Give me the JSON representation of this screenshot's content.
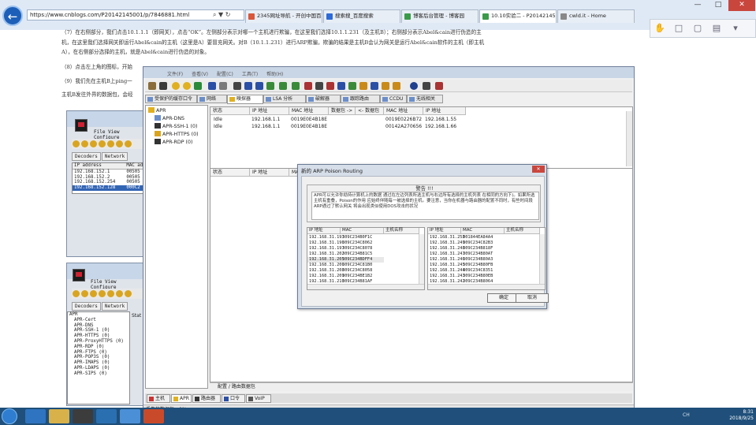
{
  "browser": {
    "address": "https://www.cnblogs.com/P20142145001/p/7846881.html",
    "tabs": [
      "2345网址导航 - 开创中国百年...",
      "搜索搜_百度搜索",
      "博客后台管理 - 博客园",
      "10.10实验二 - P20142145...",
      "cwld.it - Home"
    ],
    "window_buttons": [
      "—",
      "□",
      "✕"
    ]
  },
  "article": {
    "p1": "（7）在右侧部分，我们点击10.1.1.1（即网关），点击“OK”。左侧部分表示对哪一个主机进行欺骗，在这里我们选择10.1.1.231（及主机B）；右侧部分表示Abel&cain进行伪造的主",
    "p1b": "机，在这里我们选择网关即运行Abel&cain的主机（这里是A）要冒充网关。对B（10.1.1.231）进行ARP欺骗，欺骗的结果是主机B会认为网关是运行Abel&cain软件的主机（即主机",
    "p1c": "A），在右侧部分选择的主机，就是Abel&cain进行伪造的对象。",
    "p2": "（8）点击左上角的图标，开始",
    "p3": "（9）我们先在主机B上ping一",
    "p4": "主机B发往外界的数据包，会经"
  },
  "small_win1": {
    "menu": "File  View  Configure",
    "tabs": [
      "Decoders",
      "Network"
    ],
    "table_header": "IP address",
    "table_header2": "MAC ad",
    "rows": [
      {
        "ip": "192.168.152.1",
        "mac": "00505"
      },
      {
        "ip": "192.168.152.2",
        "mac": "00505"
      },
      {
        "ip": "192.168.152.254",
        "mac": "00505"
      },
      {
        "ip": "192.168.152.128",
        "mac": "000C2"
      }
    ]
  },
  "small_win2": {
    "menu": "File  View  Configure",
    "tabs": [
      "Decoders",
      "Network"
    ],
    "stat": "Stat",
    "tree": [
      "APR",
      "APR-Cert",
      "APR-DNS",
      "APR-SSH-1 (0)",
      "APR-HTTPS (0)",
      "APR-ProxyHTTPS (0)",
      "APR-RDP (0)",
      "APR-FTPS (0)",
      "APR-POP3S (0)",
      "APR-IMAPS (0)",
      "APR-LDAPS (0)",
      "APR-SIPS (0)"
    ]
  },
  "cain": {
    "menu": [
      "文件(F)",
      "查看(V)",
      "配置(C)",
      "工具(T)",
      "帮助(H)"
    ],
    "tabs": [
      "受保护的缓存口令",
      "网络",
      "嗅探器",
      "LSA 分析",
      "破解器",
      "跟踪路由",
      "CCDU",
      "无线相关"
    ],
    "tree": [
      "APR",
      "APR-DNS",
      "APR-SSH-1 (0)",
      "APR-HTTPS (0)",
      "APR-RDP (0)"
    ],
    "table1_headers": [
      "状态",
      "IP 地址",
      "MAC 地址",
      "数据包 ->",
      "<- 数据包",
      "MAC 地址",
      "IP 地址"
    ],
    "table1_rows": [
      [
        "Idle",
        "192.168.1.1",
        "0019E0E4B18E",
        "",
        "",
        "0019E0226B72",
        "192.168.1.55"
      ],
      [
        "Idle",
        "192.168.1.1",
        "0019E0E4B18E",
        "",
        "",
        "00142A270656",
        "192.168.1.66"
      ]
    ],
    "table2_headers": [
      "状态",
      "IP 地址",
      "MAC 地址"
    ],
    "bottom_tab": "配置 / 路由数据包",
    "bottom_tabs": [
      "主机",
      "APR",
      "路由器",
      "口令",
      "VoIP"
    ],
    "status": "丢失的数据包：0%"
  },
  "dialog": {
    "title": "新的 ARP Poison Routing",
    "close": "✕",
    "warning_title": "警告 !!!",
    "warning_text": "APR可以允许你劫持计算机上的数据 通过在左边列表所选主机与右边所有选择的主机列表 在相同的方向下)。如果所选主机有重叠，Poison的作用 应始终伴随每一被选择的主机。要注意，当你在机器与路由器的配置不同时，有些时间段ARP通过了默认网关 将会出现类似使用DOS攻击的状况",
    "left_headers": [
      "IP 地址",
      "MAC",
      "主机名称"
    ],
    "right_headers": [
      "IP 地址",
      "MAC",
      "主机名称"
    ],
    "left_rows": [
      [
        "192.168.31.193",
        "309C234B0F1C"
      ],
      [
        "192.168.31.196",
        "309C234C8062"
      ],
      [
        "192.168.31.197",
        "309C234C8078"
      ],
      [
        "192.168.31.202",
        "309C234B81C5"
      ],
      [
        "192.168.31.205",
        "309C234BDFF4"
      ],
      [
        "192.168.31.206",
        "309C234C81B0"
      ],
      [
        "192.168.31.208",
        "309C234C8058"
      ],
      [
        "192.168.31.209",
        "309C234BE1B2"
      ],
      [
        "192.168.31.210",
        "309C234B81AF"
      ],
      [
        "192.168.31.211",
        "309C234C8079"
      ]
    ],
    "right_rows": [
      [
        "192.168.31.253",
        "001844EA84A4"
      ],
      [
        "192.168.31.249",
        "309C234C82B3"
      ],
      [
        "192.168.31.248",
        "309C234B818F"
      ],
      [
        "192.168.31.247",
        "309C234B80AT"
      ],
      [
        "192.168.31.246",
        "309C234B80A3"
      ],
      [
        "192.168.31.245",
        "309C234B80FB"
      ],
      [
        "192.168.31.244",
        "309C234C8351"
      ],
      [
        "192.168.31.243",
        "309C234B80EB"
      ],
      [
        "192.168.31.242",
        "309C234B8064"
      ],
      [
        "192.168.31.241",
        "309C234B8096"
      ]
    ],
    "ok": "确定",
    "cancel": "取消"
  },
  "taskbar": {
    "tray": "CH",
    "time": "8:31",
    "date": "2018/9/25"
  }
}
